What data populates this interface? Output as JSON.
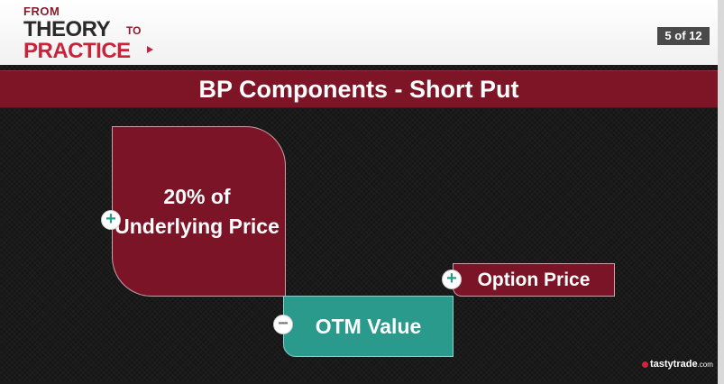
{
  "logo": {
    "from": "FROM",
    "theory": "THEORY",
    "to": "TO",
    "practice": "PRACTICE"
  },
  "page_counter": "5 of 12",
  "title": "BP Components - Short Put",
  "components": {
    "underlying": {
      "sign": "+",
      "label": "20% of Underlying Price"
    },
    "otm": {
      "sign": "−",
      "label": "OTM Value"
    },
    "option": {
      "sign": "+",
      "label": "Option Price"
    }
  },
  "watermark": {
    "name": "tastytrade",
    "suffix": ".com"
  },
  "colors": {
    "maroon": "#7b1426",
    "teal": "#2a9a8c",
    "logo_red": "#c8233a"
  }
}
